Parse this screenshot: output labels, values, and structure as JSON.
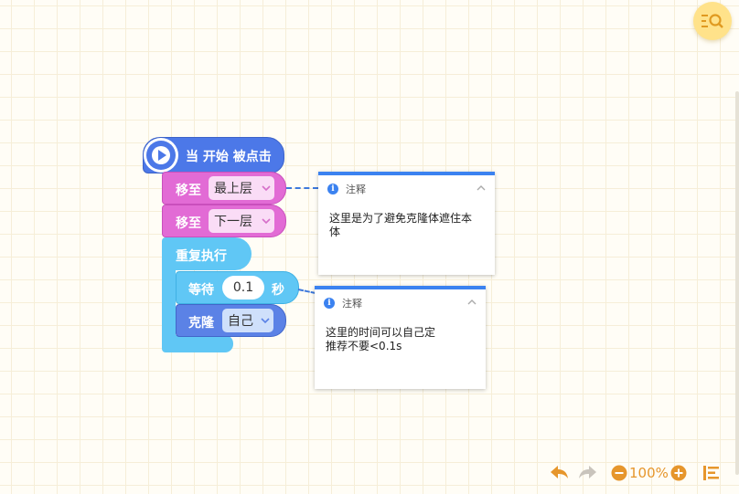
{
  "colors": {
    "event": "#4c78e8",
    "looks": "#e26bd5",
    "control": "#60c7f5",
    "clone": "#5b82e6",
    "note_accent": "#3b82f0",
    "toolbar": "#e6962c"
  },
  "icons": {
    "top_button": "search-list-icon",
    "flag": "play-icon",
    "undo": "undo-icon",
    "redo": "redo-icon",
    "zoom_out": "zoom-out-icon",
    "zoom_in": "zoom-in-icon",
    "arrange": "arrange-icon"
  },
  "blocks": {
    "hat": {
      "label": "当 开始 被点击"
    },
    "move1": {
      "label": "移至",
      "value": "最上层"
    },
    "move2": {
      "label": "移至",
      "value": "下一层"
    },
    "loop": {
      "label": "重复执行"
    },
    "wait": {
      "label": "等待",
      "value": "0.1",
      "unit": "秒"
    },
    "clone": {
      "label": "克隆",
      "value": "自己"
    }
  },
  "notes": [
    {
      "title": "注释",
      "text": "这里是为了避免克隆体遮住本\n体"
    },
    {
      "title": "注释",
      "text": "这里的时间可以自己定\n推荐不要<0.1s"
    }
  ],
  "toolbar": {
    "zoom": "100%"
  }
}
